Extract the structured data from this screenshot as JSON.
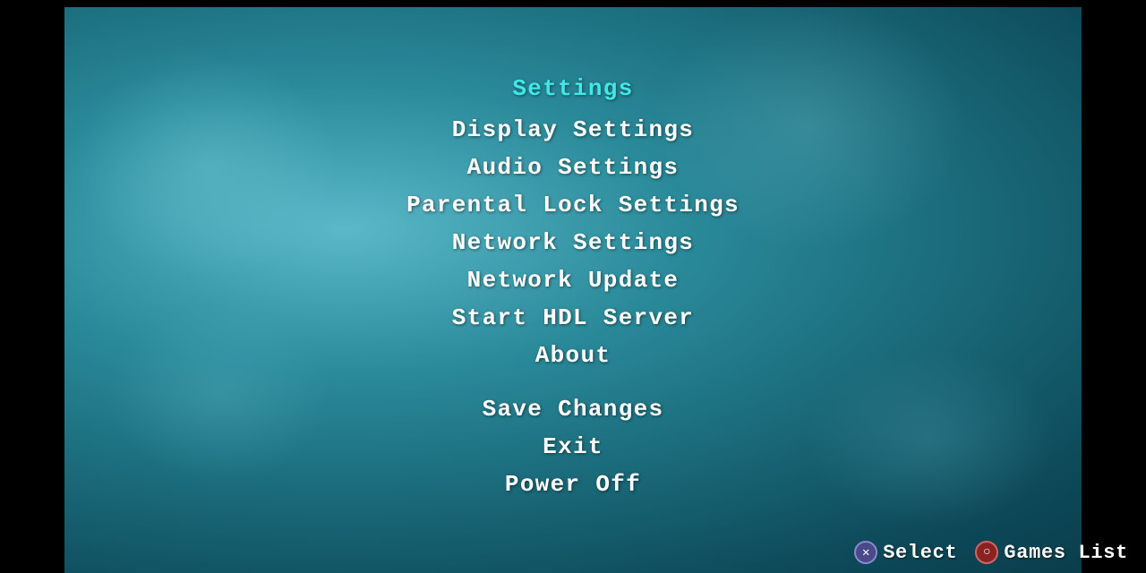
{
  "menu": {
    "title": "Settings",
    "items": [
      {
        "label": "Display Settings",
        "id": "display-settings"
      },
      {
        "label": "Audio Settings",
        "id": "audio-settings"
      },
      {
        "label": "Parental Lock Settings",
        "id": "parental-lock-settings"
      },
      {
        "label": "Network Settings",
        "id": "network-settings"
      },
      {
        "label": "Network Update",
        "id": "network-update"
      },
      {
        "label": "Start HDL Server",
        "id": "start-hdl-server"
      },
      {
        "label": "About",
        "id": "about"
      }
    ],
    "actions": [
      {
        "label": "Save Changes",
        "id": "save-changes"
      },
      {
        "label": "Exit",
        "id": "exit"
      },
      {
        "label": "Power Off",
        "id": "power-off"
      }
    ]
  },
  "controls": {
    "select": {
      "icon": "✕",
      "label": "Select"
    },
    "games_list": {
      "icon": "○",
      "label": "Games List"
    }
  },
  "colors": {
    "title": "#40e8e8",
    "menu_text": "#ffffff",
    "x_button_bg": "#4a4a8a",
    "circle_button_bg": "#8a2222"
  }
}
